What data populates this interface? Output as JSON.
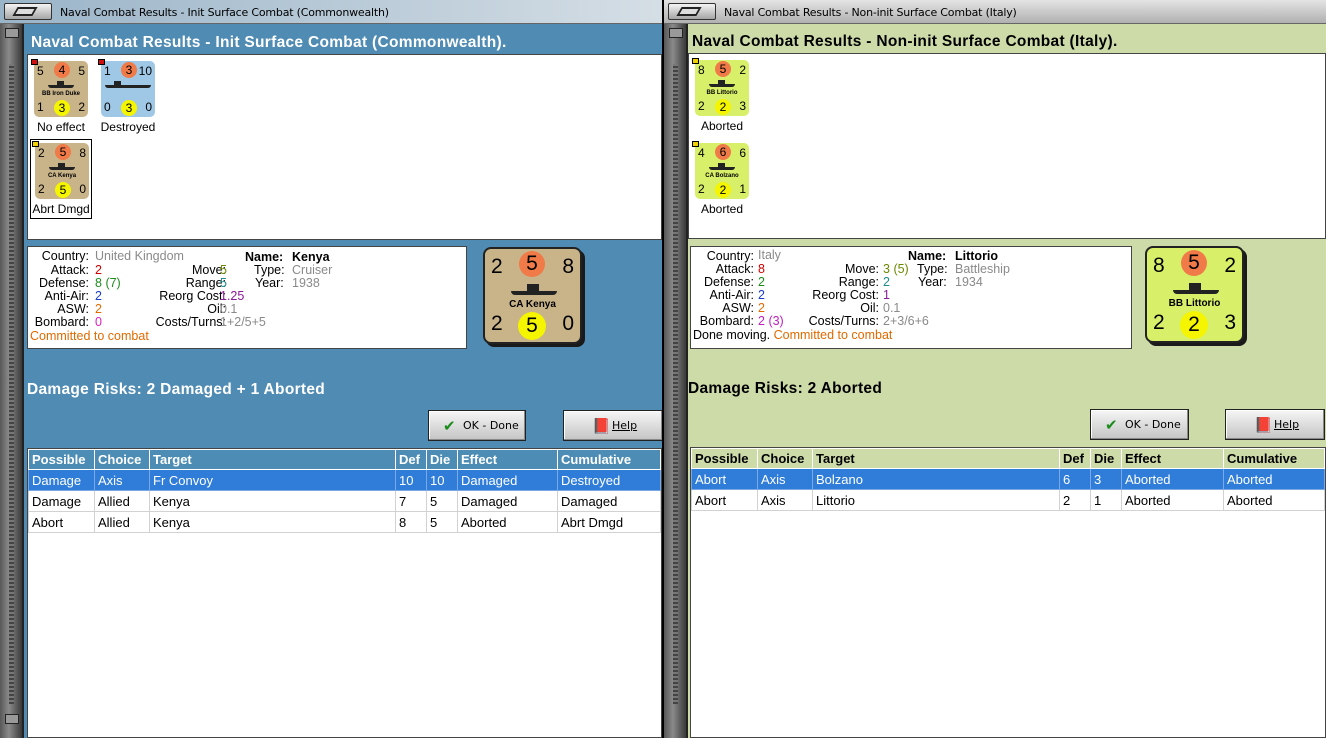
{
  "left": {
    "window_title": "Naval Combat Results - Init Surface Combat (Commonwealth)",
    "dialog_title": "Naval Combat Results - Init Surface Combat (Commonwealth).",
    "counters": [
      {
        "tl": "5",
        "tm": "4",
        "tr": "5",
        "bl": "1",
        "bm": "3",
        "br": "2",
        "name": "BB Iron Duke",
        "label": "No effect",
        "color": "tan"
      },
      {
        "tl": "1",
        "tm": "3",
        "tr": "10",
        "bl": "0",
        "bm": "3",
        "br": "0",
        "name": "",
        "label": "Destroyed",
        "color": "blue"
      },
      {
        "tl": "2",
        "tm": "5",
        "tr": "8",
        "bl": "2",
        "bm": "5",
        "br": "0",
        "name": "CA Kenya",
        "label": "Abrt Dmgd",
        "color": "tan"
      }
    ],
    "info": {
      "country_label": "Country:",
      "country": "United Kingdom",
      "attack_label": "Attack:",
      "attack": "2",
      "defense_label": "Defense:",
      "defense": "8",
      "defense_extra": "(7)",
      "antiair_label": "Anti-Air:",
      "antiair": "2",
      "asw_label": "ASW:",
      "asw": "2",
      "bombard_label": "Bombard:",
      "bombard": "0",
      "name_label": "Name:",
      "name": "Kenya",
      "move_label": "Move:",
      "move": "5",
      "range_label": "Range:",
      "range": "5",
      "reorg_label": "Reorg Cost:",
      "reorg": "1.25",
      "oil_label": "Oil:",
      "oil": "0.1",
      "costs_label": "Costs/Turns:",
      "costs": "1+2/5+5",
      "type_label": "Type:",
      "type": "Cruiser",
      "year_label": "Year:",
      "year": "1938",
      "status": "Committed to combat"
    },
    "big_counter": {
      "tl": "2",
      "tm": "5",
      "tr": "8",
      "bl": "2",
      "bm": "5",
      "br": "0",
      "name": "CA Kenya"
    },
    "damage_risks": "Damage Risks:  2 Damaged + 1 Aborted",
    "ok_label": "OK - Done",
    "help_label": "Help",
    "columns": [
      "Possible",
      "Choice",
      "Target",
      "Def",
      "Die",
      "Effect",
      "Cumulative"
    ],
    "rows": [
      [
        "Damage",
        "Axis",
        "Fr Convoy",
        "10",
        "10",
        "Damaged",
        "Destroyed"
      ],
      [
        "Damage",
        "Allied",
        "Kenya",
        "7",
        "5",
        "Damaged",
        "Damaged"
      ],
      [
        "Abort",
        "Allied",
        "Kenya",
        "8",
        "5",
        "Aborted",
        "Abrt Dmgd"
      ]
    ]
  },
  "right": {
    "window_title": "Naval Combat Results - Non-init Surface Combat (Italy)",
    "dialog_title": "Naval Combat Results - Non-init Surface Combat (Italy).",
    "counters": [
      {
        "tl": "8",
        "tm": "5",
        "tr": "2",
        "bl": "2",
        "bm": "2",
        "br": "3",
        "name": "BB Littorio",
        "label": "Aborted",
        "color": "green"
      },
      {
        "tl": "4",
        "tm": "6",
        "tr": "6",
        "bl": "2",
        "bm": "2",
        "br": "1",
        "name": "CA Bolzano",
        "label": "Aborted",
        "color": "green"
      }
    ],
    "info": {
      "country_label": "Country:",
      "country": "Italy",
      "attack_label": "Attack:",
      "attack": "8",
      "defense_label": "Defense:",
      "defense": "2",
      "antiair_label": "Anti-Air:",
      "antiair": "2",
      "asw_label": "ASW:",
      "asw": "2",
      "bombard_label": "Bombard:",
      "bombard": "2",
      "bombard_extra": "(3)",
      "name_label": "Name:",
      "name": "Littorio",
      "move_label": "Move:",
      "move": "3",
      "move_extra": "(5)",
      "range_label": "Range:",
      "range": "2",
      "reorg_label": "Reorg Cost:",
      "reorg": "1",
      "oil_label": "Oil:",
      "oil": "0.1",
      "costs_label": "Costs/Turns:",
      "costs": "2+3/6+6",
      "type_label": "Type:",
      "type": "Battleship",
      "year_label": "Year:",
      "year": "1934",
      "status_prefix": "Done moving.",
      "status": "Committed to combat"
    },
    "big_counter": {
      "tl": "8",
      "tm": "5",
      "tr": "2",
      "bl": "2",
      "bm": "2",
      "br": "3",
      "name": "BB Littorio"
    },
    "damage_risks": "Damage Risks:  2 Aborted",
    "ok_label": "OK - Done",
    "help_label": "Help",
    "columns": [
      "Possible",
      "Choice",
      "Target",
      "Def",
      "Die",
      "Effect",
      "Cumulative"
    ],
    "rows": [
      [
        "Abort",
        "Axis",
        "Bolzano",
        "6",
        "3",
        "Aborted",
        "Aborted"
      ],
      [
        "Abort",
        "Axis",
        "Littorio",
        "2",
        "1",
        "Aborted",
        "Aborted"
      ]
    ]
  },
  "colors": {
    "left_bg": "#4f8bb3",
    "right_bg": "#cddba9",
    "selected_row": "#2f7dd9",
    "status_orange": "#e06a00",
    "grey_value": "#8a8a8a"
  }
}
